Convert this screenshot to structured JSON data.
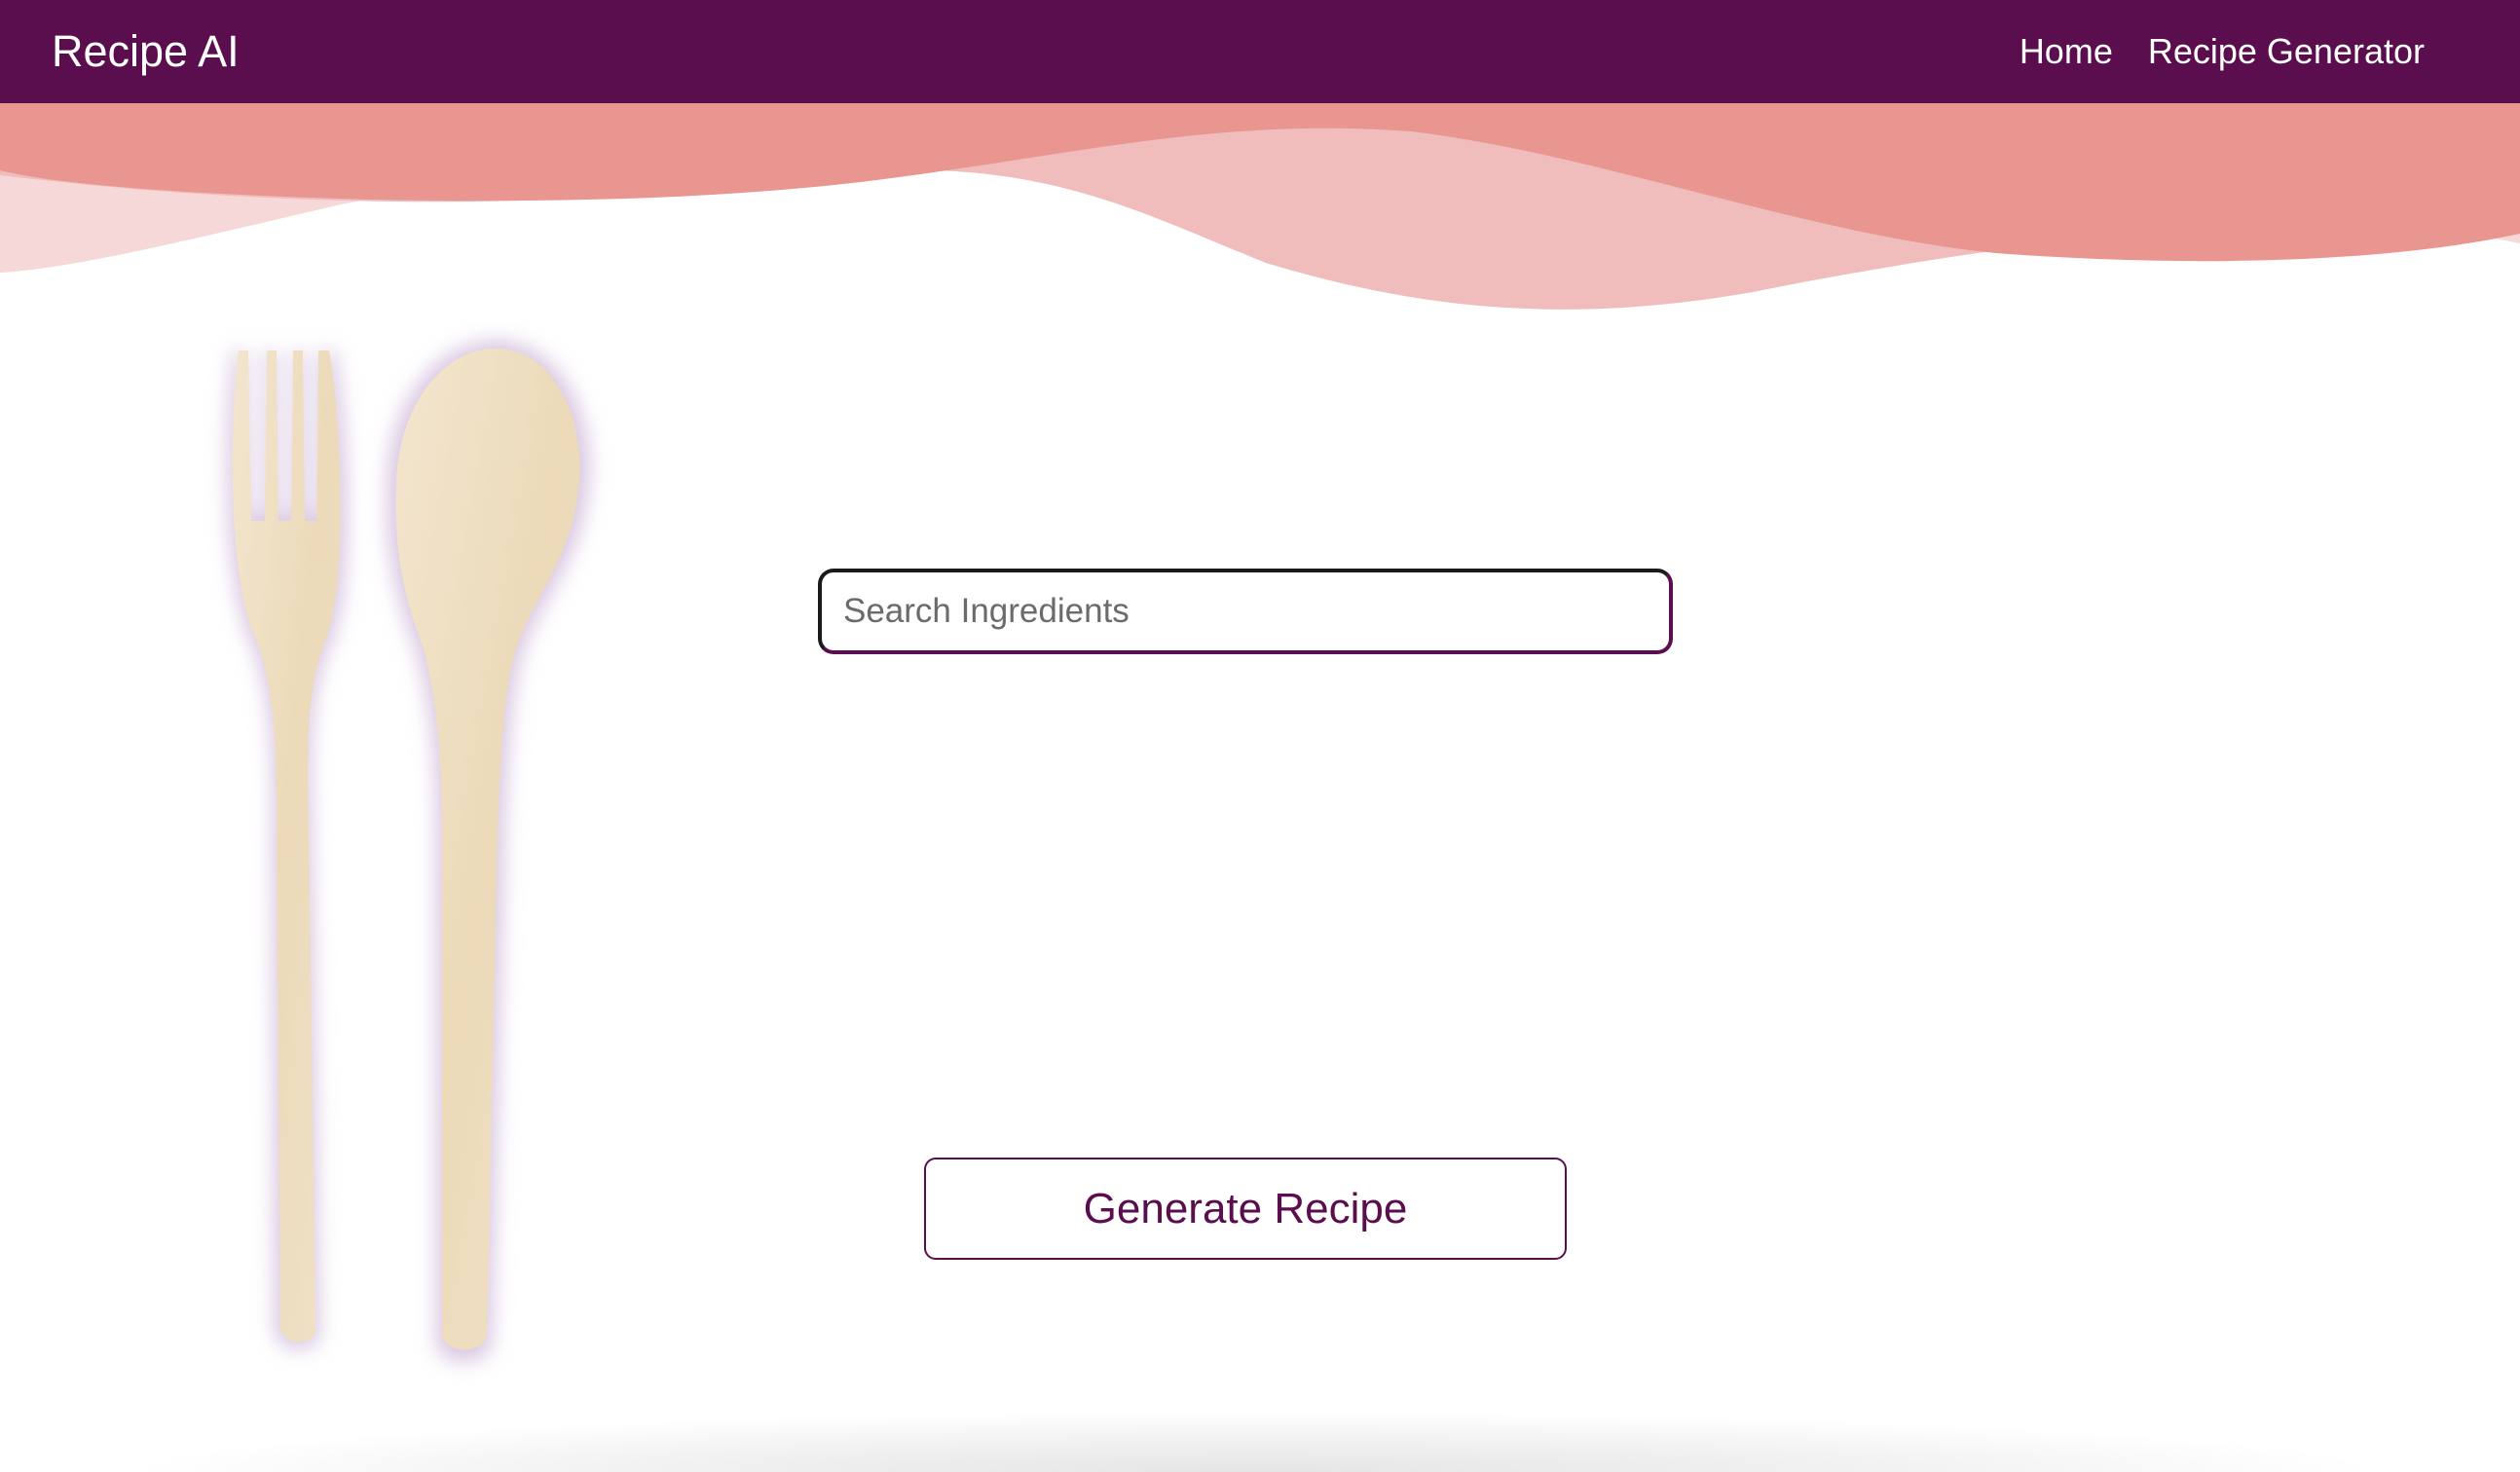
{
  "navbar": {
    "brand": "Recipe AI",
    "links": [
      {
        "label": "Home"
      },
      {
        "label": "Recipe Generator"
      }
    ],
    "background": "#5a0e4e"
  },
  "search": {
    "placeholder": "Search Ingredients",
    "value": ""
  },
  "actions": {
    "generate_label": "Generate Recipe"
  },
  "decor": {
    "wave_colors": [
      "#e8968f",
      "#f0bcbc",
      "#f6d8d8"
    ],
    "utensils_icon": "fork-and-spoon",
    "accent": "#5a0e4e"
  }
}
